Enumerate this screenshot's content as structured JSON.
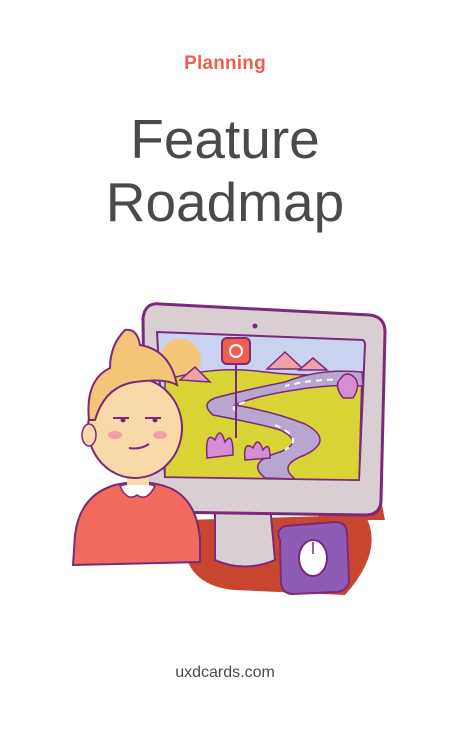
{
  "card": {
    "category": "Planning",
    "title_line1": "Feature",
    "title_line2": "Roadmap",
    "footer": "uxdcards.com"
  },
  "illustration": {
    "subject": "person-at-computer-roadmap-icon",
    "colors": {
      "accent": "#ef5f4c",
      "monitor_frame": "#d9cfd3",
      "outline": "#7a2a78",
      "road": "#b7a6cf",
      "grass": "#d8d436",
      "sky": "#c9d3f0",
      "shadow": "#c8452f",
      "shirt": "#f26a5e",
      "hair": "#f4c477",
      "skin": "#f9d9a8"
    }
  }
}
